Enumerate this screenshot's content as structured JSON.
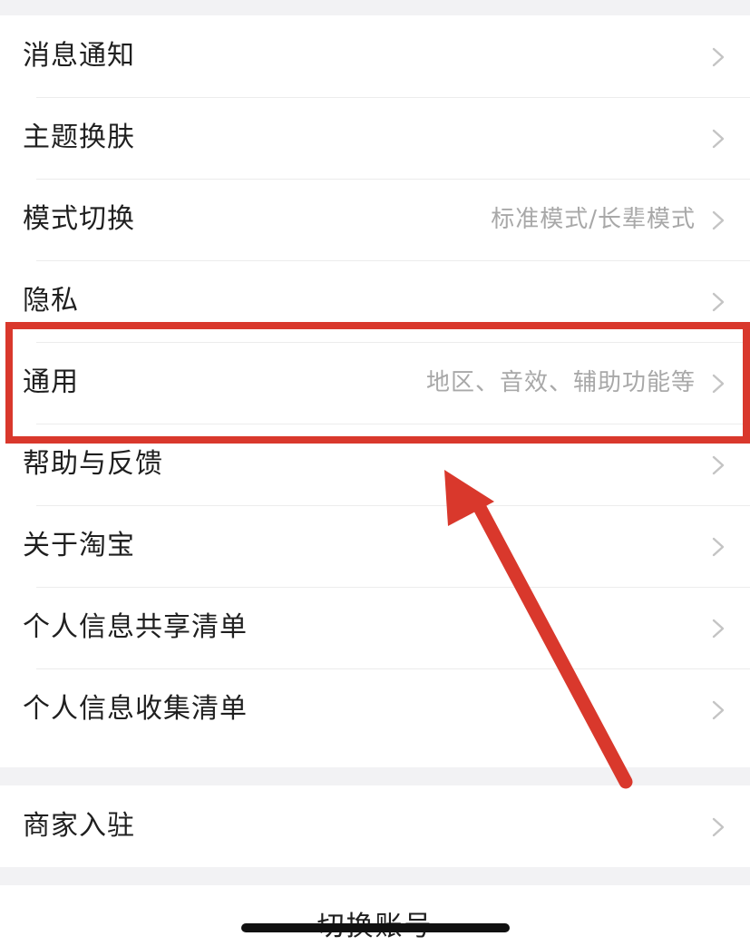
{
  "settings_list": [
    {
      "label": "消息通知",
      "detail": ""
    },
    {
      "label": "主题换肤",
      "detail": ""
    },
    {
      "label": "模式切换",
      "detail": "标准模式/长辈模式"
    },
    {
      "label": "隐私",
      "detail": ""
    },
    {
      "label": "通用",
      "detail": "地区、音效、辅助功能等"
    },
    {
      "label": "帮助与反馈",
      "detail": ""
    },
    {
      "label": "关于淘宝",
      "detail": ""
    },
    {
      "label": "个人信息共享清单",
      "detail": ""
    },
    {
      "label": "个人信息收集清单",
      "detail": ""
    }
  ],
  "merchant": {
    "label": "商家入驻"
  },
  "account": {
    "switch_label": "切换账号"
  },
  "annotation": {
    "highlighted_item": "通用",
    "color": "#d9382c"
  },
  "icons": {
    "chevron": "chevron-right-icon"
  }
}
